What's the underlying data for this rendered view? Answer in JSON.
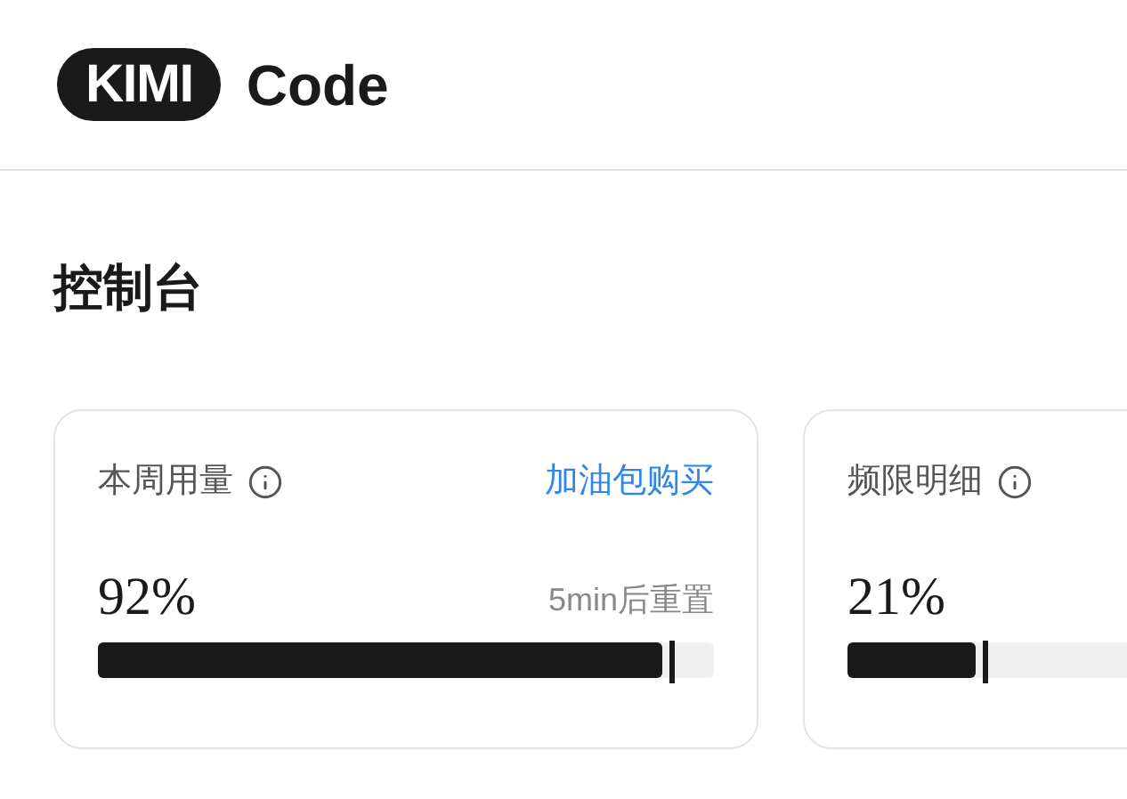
{
  "header": {
    "logo_badge": "KIMI",
    "logo_text": "Code"
  },
  "page_title": "控制台",
  "cards": [
    {
      "title": "本周用量",
      "link": "加油包购买",
      "value": "92%",
      "reset": "5min后重置",
      "level": 0.92
    },
    {
      "title": "频限明细",
      "value": "21%",
      "level": 0.21
    }
  ]
}
